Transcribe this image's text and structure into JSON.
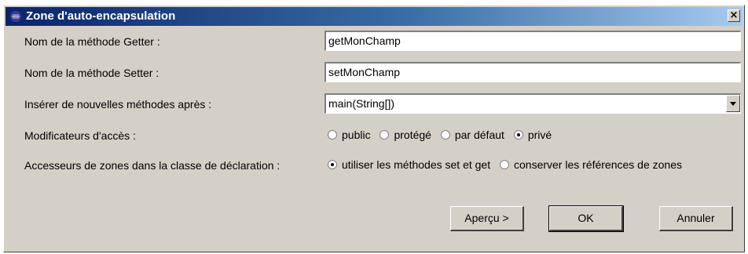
{
  "window": {
    "title": "Zone d'auto-encapsulation",
    "close_label": "×"
  },
  "form": {
    "getter": {
      "label": "Nom de la méthode Getter :",
      "value": "getMonChamp"
    },
    "setter": {
      "label": "Nom de la méthode Setter :",
      "value": "setMonChamp"
    },
    "insert_after": {
      "label": "Insérer de nouvelles méthodes après :",
      "value": "main(String[])"
    },
    "access_modifiers": {
      "label": "Modificateurs d'accès :",
      "options": [
        {
          "label": "public",
          "checked": false
        },
        {
          "label": "protégé",
          "checked": false
        },
        {
          "label": "par défaut",
          "checked": false
        },
        {
          "label": "privé",
          "checked": true
        }
      ]
    },
    "field_access": {
      "label": "Accesseurs de zones dans la classe de déclaration :",
      "options": [
        {
          "label": "utiliser les méthodes set et get",
          "checked": true
        },
        {
          "label": "conserver les références de zones",
          "checked": false
        }
      ]
    }
  },
  "buttons": {
    "preview": "Aperçu >",
    "ok": "OK",
    "cancel": "Annuler"
  }
}
